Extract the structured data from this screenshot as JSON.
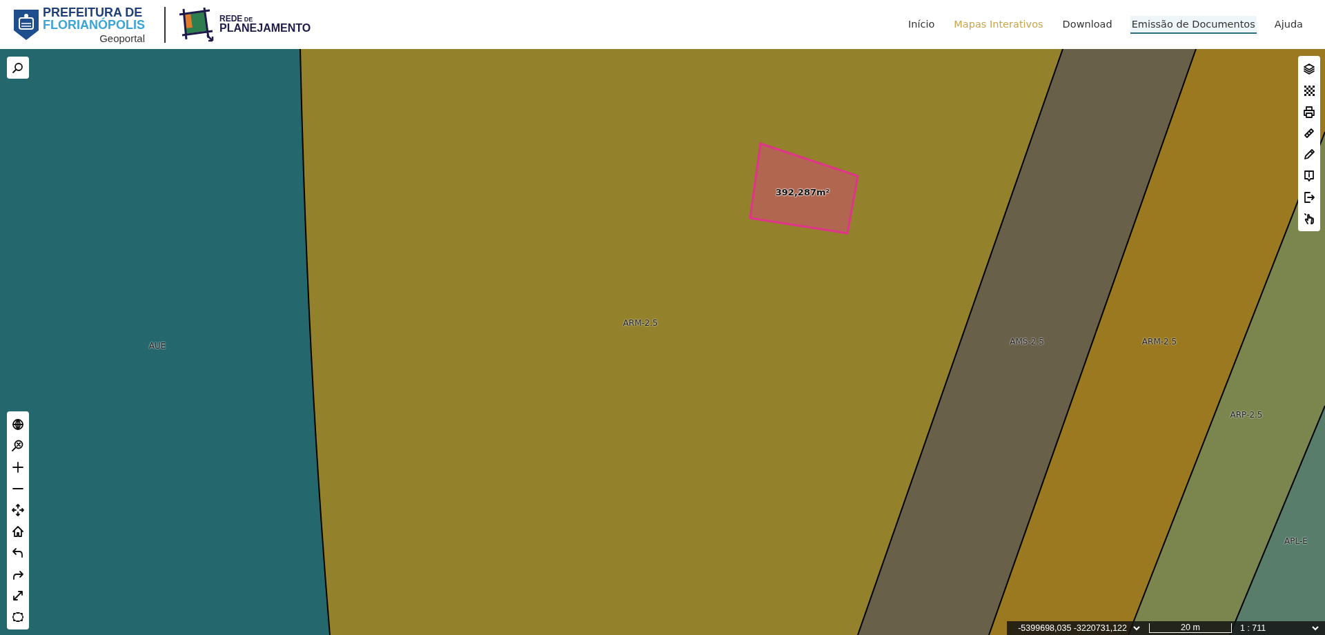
{
  "header": {
    "logo": {
      "line1": "PREFEITURA DE",
      "line2": "FLORIANÓPOLIS",
      "subtitle": "Geoportal"
    },
    "partner_logo": {
      "line1": "REDE",
      "line1_small": "DE",
      "line2": "PLANEJAMENTO"
    }
  },
  "nav": [
    {
      "label": "Início",
      "current": false,
      "selected": false
    },
    {
      "label": "Mapas Interativos",
      "current": true,
      "selected": false
    },
    {
      "label": "Download",
      "current": false,
      "selected": false
    },
    {
      "label": "Emissão de Documentos",
      "current": false,
      "selected": true
    },
    {
      "label": "Ajuda",
      "current": false,
      "selected": false
    }
  ],
  "map": {
    "zones": [
      {
        "label": "AUE",
        "color": "#1d6b7a"
      },
      {
        "label": "ARM-2.5",
        "color": "#a08a2c"
      },
      {
        "label": "AMS-2.5",
        "color": "#6e6250"
      },
      {
        "label": "ARM-2.5",
        "color": "#a87f1f"
      },
      {
        "label": "ARP-2.5",
        "color": "#848e55"
      },
      {
        "label": "APL-E",
        "color": "#5b8577"
      }
    ],
    "measurement": {
      "label": "392,287m²"
    }
  },
  "status_bar": {
    "coordinates": "-5399698,035 -3220731,122",
    "scale_bar": "20 m",
    "scale": "1 : 711"
  }
}
